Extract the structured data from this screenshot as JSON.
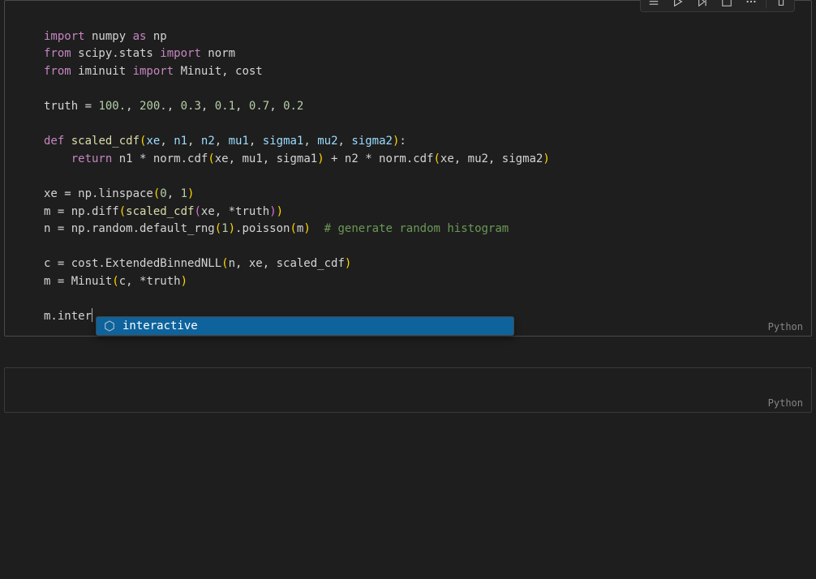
{
  "toolbar": {
    "btn_run": "run-cell-icon",
    "btn_run_by": "run-by-line-icon",
    "btn_execute_below": "execute-below-icon",
    "btn_split": "split-cell-icon",
    "btn_more": "more-icon",
    "btn_delete": "delete-icon"
  },
  "cell1": {
    "language": "Python",
    "code": {
      "l1": {
        "kw1": "import",
        "mod": " numpy ",
        "kw2": "as",
        "alias": " np"
      },
      "l2": {
        "kw1": "from",
        "mod": " scipy.stats ",
        "kw2": "import",
        "names": " norm"
      },
      "l3": {
        "kw1": "from",
        "mod": " iminuit ",
        "kw2": "import",
        "names": " Minuit, cost"
      },
      "l4": "",
      "l5": {
        "pre": "truth = ",
        "n1": "100.",
        "c1": ", ",
        "n2": "200.",
        "c2": ", ",
        "n3": "0.3",
        "c3": ", ",
        "n4": "0.1",
        "c4": ", ",
        "n5": "0.7",
        "c5": ", ",
        "n6": "0.2"
      },
      "l6": "",
      "l7": {
        "kw": "def",
        "sp": " ",
        "fn": "scaled_cdf",
        "op": "(",
        "p1": "xe",
        "c1": ", ",
        "p2": "n1",
        "c2": ", ",
        "p3": "n2",
        "c3": ", ",
        "p4": "mu1",
        "c4": ", ",
        "p5": "sigma1",
        "c5": ", ",
        "p6": "mu2",
        "c6": ", ",
        "p7": "sigma2",
        "cp": ")",
        "col": ":"
      },
      "l8": {
        "indent": "    ",
        "kw": "return",
        "txt1": " n1 * norm.cdf",
        "op1": "(",
        "args1": "xe, mu1, sigma1",
        "cp1": ")",
        "txt2": " + n2 * norm.cdf",
        "op2": "(",
        "args2": "xe, mu2, sigma2",
        "cp2": ")"
      },
      "l9": "",
      "l10": {
        "pre": "xe = np.linspace",
        "op": "(",
        "n1": "0",
        "c": ", ",
        "n2": "1",
        "cp": ")"
      },
      "l11": {
        "pre": "m = np.diff",
        "op1": "(",
        "fn": "scaled_cdf",
        "op2": "(",
        "args": "xe, *truth",
        "cp2": ")",
        "cp1": ")"
      },
      "l12": {
        "pre": "n = np.random.default_rng",
        "op": "(",
        "n": "1",
        "cp": ")",
        "post": ".poisson",
        "op2": "(",
        "arg2": "m",
        "cp2": ")",
        "sp": "  ",
        "cmt": "# generate random histogram"
      },
      "l13": "",
      "l14": {
        "pre": "c = cost.ExtendedBinnedNLL",
        "op": "(",
        "args": "n, xe, scaled_cdf",
        "cp": ")"
      },
      "l15": {
        "pre": "m = Minuit",
        "op": "(",
        "args": "c, *truth",
        "cp": ")"
      },
      "l16": "",
      "l17": {
        "txt": "m.inter"
      }
    }
  },
  "autocomplete": {
    "items": [
      {
        "label": "interactive",
        "kind": "method"
      }
    ]
  },
  "cell2": {
    "language": "Python"
  }
}
